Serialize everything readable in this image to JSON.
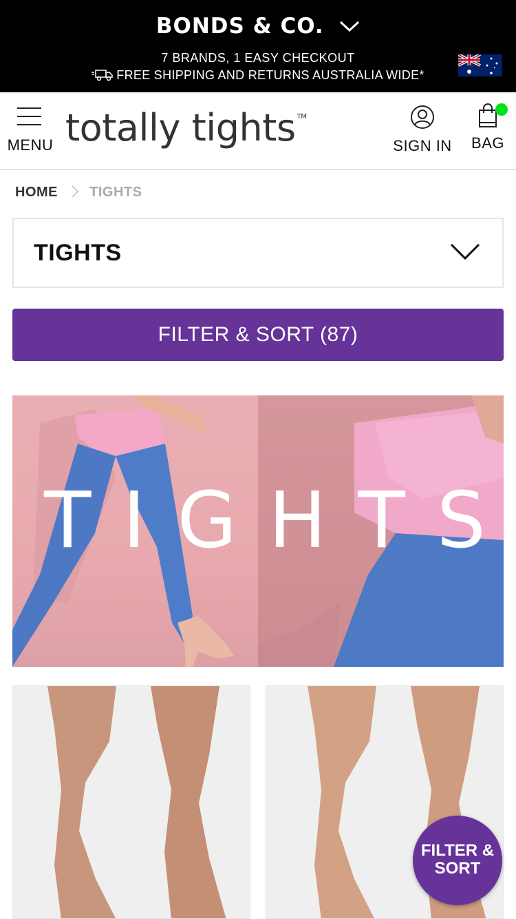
{
  "topbar": {
    "brand": "BONDS & CO.",
    "tagline": "7 BRANDS, 1 EASY CHECKOUT",
    "shipping": "FREE SHIPPING AND RETURNS AUSTRALIA WIDE*",
    "icons": [
      "chevron-down-icon",
      "truck-icon",
      "australia-flag-icon"
    ]
  },
  "header": {
    "menu_label": "MENU",
    "logo_text": "totally tights",
    "logo_tm": "TM",
    "signin_label": "SIGN IN",
    "bag_label": "BAG",
    "bag_indicator_color": "#00e21a"
  },
  "breadcrumb": {
    "home": "HOME",
    "current": "TIGHTS"
  },
  "category_select": {
    "selected": "TIGHTS"
  },
  "filter": {
    "button_label": "FILTER & SORT (87)",
    "fab_line1": "FILTER &",
    "fab_line2": "SORT",
    "accent_color": "#663399"
  },
  "banner": {
    "title": "TIGHTS"
  }
}
